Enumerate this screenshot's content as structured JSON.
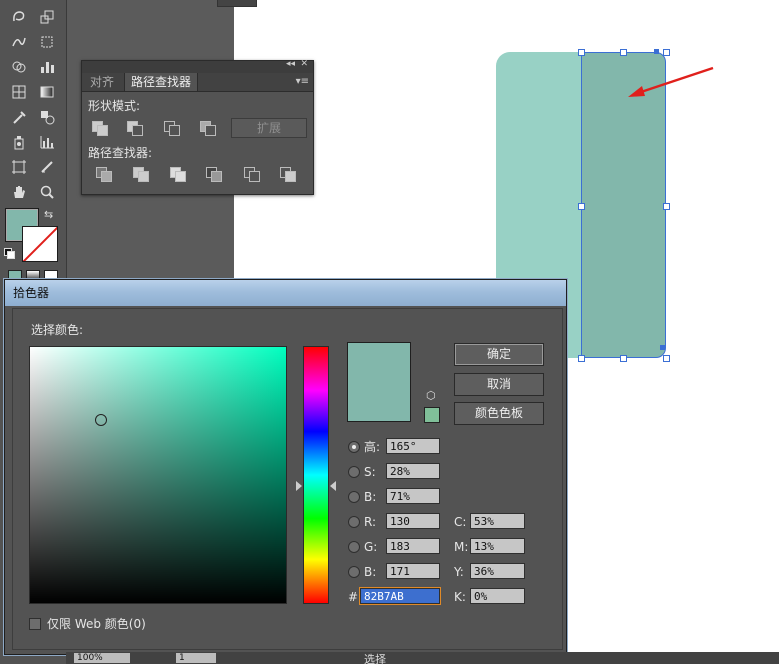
{
  "pathfinder": {
    "tab_align": "对齐",
    "tab_pathfinder": "路径查找器",
    "shape_modes_label": "形状模式:",
    "expand_label": "扩展",
    "pathfinders_label": "路径查找器:"
  },
  "picker": {
    "title": "拾色器",
    "select_color_label": "选择颜色:",
    "ok_label": "确定",
    "cancel_label": "取消",
    "swatches_label": "颜色色板",
    "fields": {
      "h_label": "高:",
      "h_value": "165°",
      "s_label": "S:",
      "s_value": "28%",
      "b_label": "B:",
      "b_value": "71%",
      "r_label": "R:",
      "r_value": "130",
      "g_label": "G:",
      "g_value": "183",
      "bl_label": "B:",
      "bl_value": "171",
      "c_label": "C:",
      "c_value": "53%",
      "m_label": "M:",
      "m_value": "13%",
      "y_label": "Y:",
      "y_value": "36%",
      "k_label": "K:",
      "k_value": "0%",
      "hex_label": "#",
      "hex_value": "82B7AB"
    },
    "web_only_label": "仅限 Web 颜色(0)",
    "current_color": "#82b7ab",
    "web_color": "#80bf99"
  },
  "status": {
    "zoom": "100%",
    "page": "1",
    "tool": "选择"
  },
  "colors": {
    "fill": "#82b7ab",
    "left_shape": "#98d1c5",
    "right_shape": "#82b7ab",
    "arrow": "#e0201c",
    "selection": "#3b6fd4"
  }
}
